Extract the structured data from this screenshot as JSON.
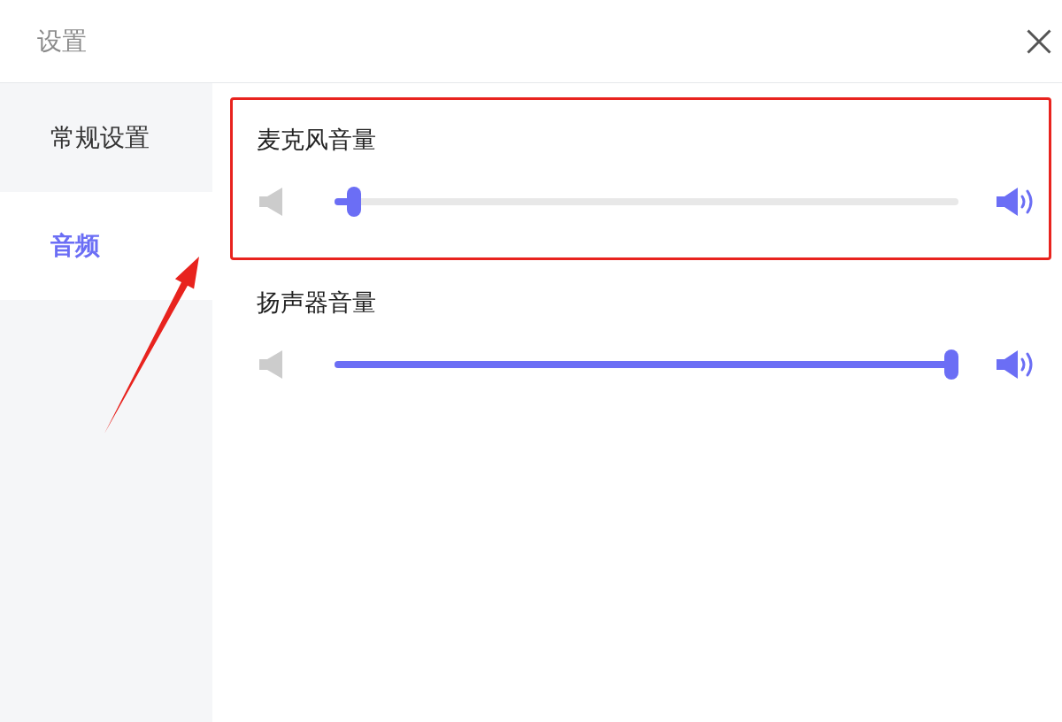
{
  "window": {
    "title": "设置"
  },
  "sidebar": {
    "items": [
      {
        "label": "常规设置",
        "selected": false
      },
      {
        "label": "音频",
        "selected": true
      }
    ]
  },
  "channels": [
    {
      "label": "麦克风音量",
      "level": 0.02,
      "highlighted": true
    },
    {
      "label": "扬声器音量",
      "level": 1,
      "highlighted": false
    }
  ]
}
